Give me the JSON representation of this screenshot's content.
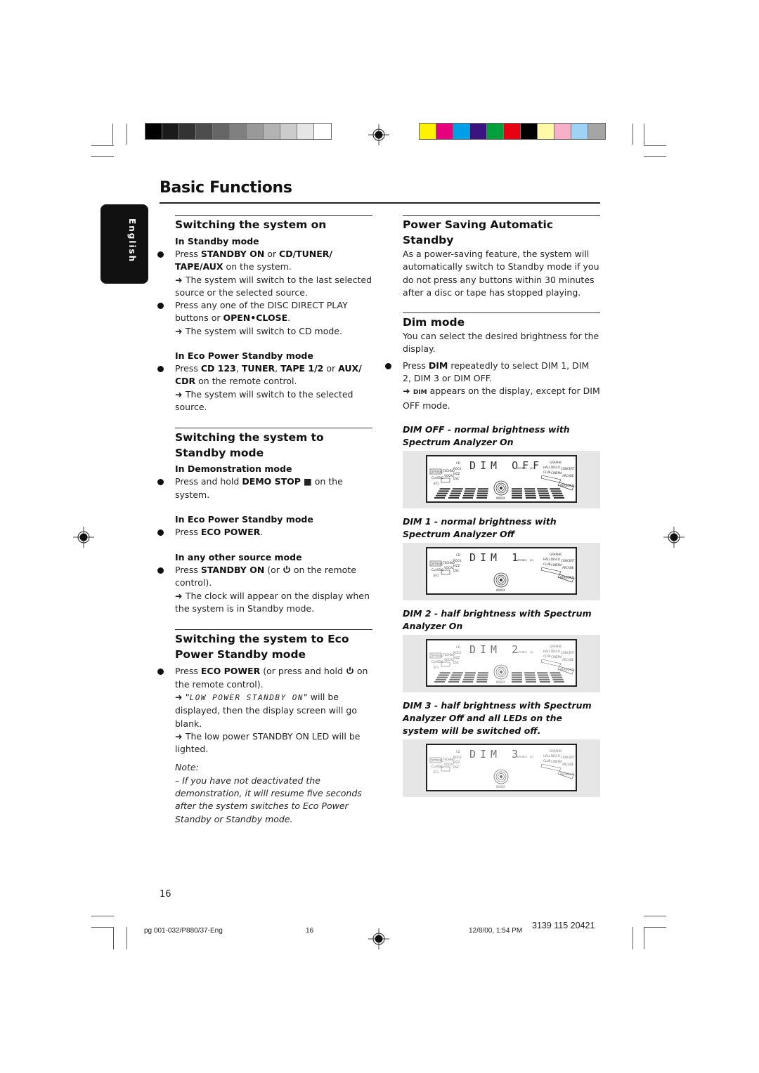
{
  "page": {
    "title": "Basic Functions",
    "language_tab": "English",
    "page_number": "16"
  },
  "print_marks": {
    "grayscale_bar": [
      "#000000",
      "#1a1a1a",
      "#333333",
      "#4d4d4d",
      "#666666",
      "#808080",
      "#999999",
      "#b3b3b3",
      "#cccccc",
      "#e6e6e6",
      "#ffffff"
    ],
    "color_bar": [
      "#fff200",
      "#e6007e",
      "#00a0e9",
      "#3c1482",
      "#00a03c",
      "#e60012",
      "#000000",
      "#fff9a8",
      "#f7b0c8",
      "#9fd3f5",
      "#a5a5a5"
    ]
  },
  "left_column": {
    "switching_on": {
      "heading": "Switching the system on",
      "standby_mode": {
        "subheading": "In Standby mode",
        "bullet1": {
          "pre": "Press ",
          "b1": "STANDBY ON",
          "mid": " or ",
          "b2": "CD/TUNER/ TAPE/AUX",
          "post": " on the system."
        },
        "result1": "The system will switch to the last selected source or the selected source.",
        "bullet2": {
          "pre": "Press any one of the DISC DIRECT PLAY buttons or ",
          "b1": "OPEN•CLOSE",
          "post": "."
        },
        "result2": "The system will switch to CD mode."
      },
      "eco_mode": {
        "subheading": "In Eco Power Standby mode",
        "bullet": {
          "pre": "Press ",
          "b1": "CD 123",
          "s1": ", ",
          "b2": "TUNER",
          "s2": ", ",
          "b3": "TAPE 1/2",
          "s3": " or ",
          "b4": "AUX/ CDR",
          "post": " on the remote control."
        },
        "result": "The system will switch to the selected source."
      }
    },
    "switching_standby": {
      "heading": "Switching the system to Standby mode",
      "demo_mode": {
        "subheading": "In Demonstration mode",
        "bullet": {
          "pre": "Press and hold ",
          "b1": "DEMO STOP",
          "icon": "■",
          "post": " on the system."
        }
      },
      "eco_mode": {
        "subheading": "In Eco Power Standby mode",
        "bullet": {
          "pre": "Press ",
          "b1": "ECO POWER",
          "post": "."
        }
      },
      "other_mode": {
        "subheading": "In any other source mode",
        "bullet": {
          "pre": "Press ",
          "b1": "STANDBY ON",
          "mid": " (or ",
          "post": " on the remote control)."
        },
        "result": "The clock will appear on the display when the system is in Standby mode."
      }
    },
    "switching_eco": {
      "heading": "Switching the system to Eco Power Standby mode",
      "bullet": {
        "pre": "Press ",
        "b1": "ECO POWER",
        "mid": " (or press and hold ",
        "post": " on the remote control)."
      },
      "result1": {
        "pre": "\"",
        "lcd": "LOW POWER STANDBY ON",
        "post": "\" will be displayed, then the display screen will go blank."
      },
      "result2": "The low power STANDBY ON LED will be lighted.",
      "note_label": "Note:",
      "note_text": "–  If you have not deactivated the demonstration, it will resume five seconds after the system switches to Eco Power Standby or Standby mode."
    }
  },
  "right_column": {
    "auto_standby": {
      "heading": "Power Saving Automatic Standby",
      "body": "As a power-saving feature, the system will automatically switch to Standby mode if you do not press any buttons within 30 minutes after a disc or tape has stopped playing."
    },
    "dim_mode": {
      "heading": "Dim mode",
      "intro": "You can select the desired brightness for the display.",
      "bullet": {
        "pre": "Press ",
        "b1": "DIM",
        "post": " repeatedly to select DIM 1, DIM 2, DIM 3 or DIM OFF."
      },
      "result": {
        "small": "DIM",
        "post": " appears on the display, except for DIM OFF mode."
      },
      "displays": [
        {
          "caption": "DIM OFF - normal brightness with Spectrum Analyzer On",
          "readout": "DIM OFF",
          "spectrum": true,
          "half": false
        },
        {
          "caption": "DIM 1 - normal brightness with Spectrum Analyzer Off",
          "readout": "DIM 1",
          "spectrum": false,
          "half": false
        },
        {
          "caption": "DIM 2 - half brightness with Spectrum Analyzer On",
          "readout": "DIM 2",
          "spectrum": true,
          "half": true
        },
        {
          "caption": "DIM 3 - half brightness with Spectrum Analyzer Off and all LEDs on the system will be switched off.",
          "readout": "DIM 3",
          "spectrum": false,
          "half": true
        }
      ],
      "lcd_labels": {
        "left": [
          "OPTIMAL",
          "TECHNO",
          "ROCK",
          "CLASSIC",
          "VOCAL",
          "JAZZ",
          "CD",
          "DSC",
          "EFX"
        ],
        "right": [
          "GRAPHIC",
          "HALL",
          "DISCO",
          "CONCERT",
          "CLUB",
          "CINEMA",
          "ARCADE",
          "PERSONAL",
          "STEREO"
        ],
        "center": "WOOX"
      }
    }
  },
  "footer": {
    "file": "pg 001-032/P880/37-Eng",
    "page": "16",
    "datetime": "12/8/00, 1:54 PM",
    "code": "3139 115 20421"
  }
}
